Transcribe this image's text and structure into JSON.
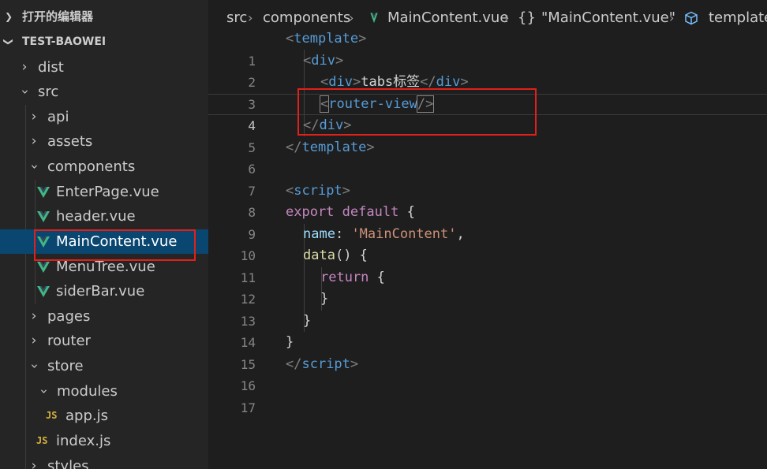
{
  "sidebar": {
    "open_editors_label": "打开的编辑器",
    "project_label": "TEST-BAOWEI",
    "items": [
      {
        "label": "dist",
        "type": "folder"
      },
      {
        "label": "src",
        "type": "folder"
      },
      {
        "label": "api",
        "type": "folder"
      },
      {
        "label": "assets",
        "type": "folder"
      },
      {
        "label": "components",
        "type": "folder"
      },
      {
        "label": "EnterPage.vue",
        "type": "vue"
      },
      {
        "label": "header.vue",
        "type": "vue"
      },
      {
        "label": "MainContent.vue",
        "type": "vue"
      },
      {
        "label": "MenuTree.vue",
        "type": "vue"
      },
      {
        "label": "siderBar.vue",
        "type": "vue"
      },
      {
        "label": "pages",
        "type": "folder"
      },
      {
        "label": "router",
        "type": "folder"
      },
      {
        "label": "store",
        "type": "folder"
      },
      {
        "label": "modules",
        "type": "folder"
      },
      {
        "label": "app.js",
        "type": "js"
      },
      {
        "label": "index.js",
        "type": "js"
      },
      {
        "label": "styles",
        "type": "folder"
      }
    ],
    "js_badge": "JS"
  },
  "breadcrumb": {
    "parts": [
      "src",
      "components",
      "MainContent.vue",
      "\"MainContent.vue\"",
      "template"
    ],
    "braces": "{}"
  },
  "code": {
    "line_numbers": [
      "1",
      "2",
      "3",
      "4",
      "5",
      "6",
      "7",
      "8",
      "9",
      "10",
      "11",
      "12",
      "13",
      "14",
      "15",
      "16",
      "17"
    ],
    "l1": {
      "open": "<",
      "tag": "template",
      "close": ">"
    },
    "l2": {
      "open": "<",
      "tag": "div",
      "close": ">"
    },
    "l3": {
      "open": "<",
      "tag": "div",
      "close": ">",
      "text": "tabs标签",
      "end_open": "</",
      "end_tag": "div",
      "end_close": ">"
    },
    "l4": {
      "open": "<",
      "tag": "router-view",
      "close": "/>"
    },
    "l5": {
      "open": "</",
      "tag": "div",
      "close": ">"
    },
    "l6": {
      "open": "</",
      "tag": "template",
      "close": ">"
    },
    "l8": {
      "open": "<",
      "tag": "script",
      "close": ">"
    },
    "l9": {
      "kw1": "export",
      "kw2": "default",
      "brace": "{"
    },
    "l10": {
      "prop": "name",
      "colon": ": ",
      "str": "'MainContent'",
      "comma": ","
    },
    "l11": {
      "fn": "data",
      "rest": "() {"
    },
    "l12": {
      "kw": "return",
      "brace": "{"
    },
    "l13": {
      "brace": "}"
    },
    "l14": {
      "brace": "}"
    },
    "l15": {
      "brace": "}"
    },
    "l16": {
      "open": "</",
      "tag": "script",
      "close": ">"
    }
  },
  "colors": {
    "selection": "#094771",
    "annotation_box": "#e0201a",
    "vue_icon": "#41b883"
  }
}
